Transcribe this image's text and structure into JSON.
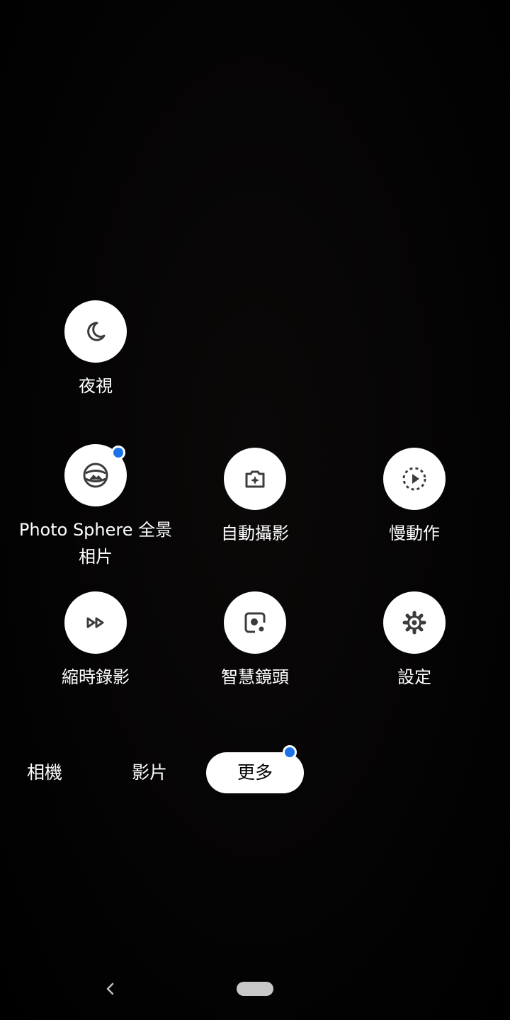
{
  "modes": {
    "night_sight": {
      "label": "夜視",
      "icon": "moon-icon"
    },
    "photo_sphere": {
      "label": "Photo Sphere 全景相片",
      "icon": "photo-sphere-icon",
      "has_badge": true
    },
    "auto_shot": {
      "label": "自動攝影",
      "icon": "camera-sparkle-icon"
    },
    "slow_motion": {
      "label": "慢動作",
      "icon": "slow-motion-play-icon"
    },
    "time_lapse": {
      "label": "縮時錄影",
      "icon": "fast-forward-icon"
    },
    "lens": {
      "label": "智慧鏡頭",
      "icon": "lens-icon"
    },
    "settings": {
      "label": "設定",
      "icon": "gear-icon"
    }
  },
  "tabs": {
    "camera": "相機",
    "video": "影片",
    "more": "更多"
  },
  "colors": {
    "accent_badge": "#1a73e8",
    "button_bg": "#ffffff",
    "icon": "#3c3c3c"
  }
}
